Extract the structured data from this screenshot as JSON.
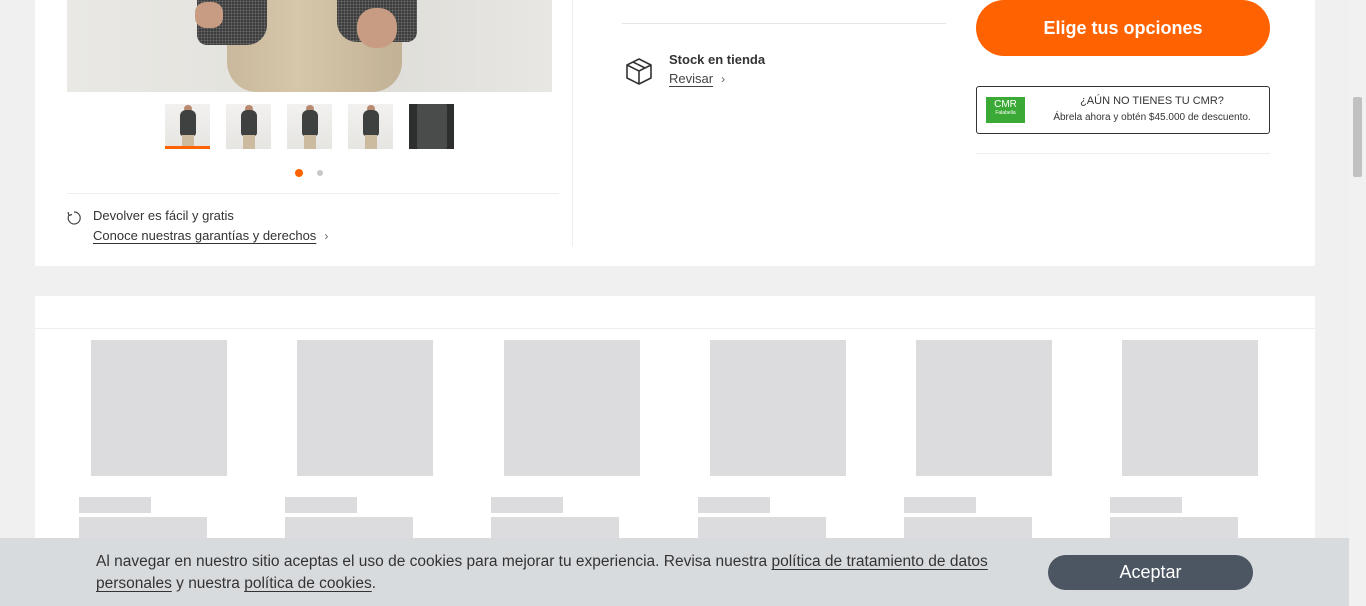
{
  "product": {
    "gallery_thumbnails": 5,
    "carousel_dots": 2,
    "return_title": "Devolver es fácil y gratis",
    "return_link": "Conoce nuestras garantías y derechos",
    "stock_title": "Stock en tienda",
    "stock_link": "Revisar",
    "options_button": "Elige tus opciones",
    "cmr_title": "¿AÚN NO TIENES TU CMR?",
    "cmr_subtitle": "Ábrela ahora y obtén $45.000 de descuento.",
    "cmr_logo": "CMR",
    "cmr_logo_sub": "Falabella",
    "accent_color": "#ff6200"
  },
  "cookie_bar": {
    "text_1": "Al navegar en nuestro sitio aceptas el uso de cookies para mejorar tu experiencia. Revisa nuestra ",
    "link_1": "política de tratamiento de datos personales",
    "text_2": " y nuestra ",
    "link_2": "política de cookies",
    "text_3": ".",
    "accept_label": "Aceptar"
  },
  "icons": {
    "return": "refresh-icon",
    "stock": "box-icon",
    "chevron": "chevron-right-icon"
  }
}
